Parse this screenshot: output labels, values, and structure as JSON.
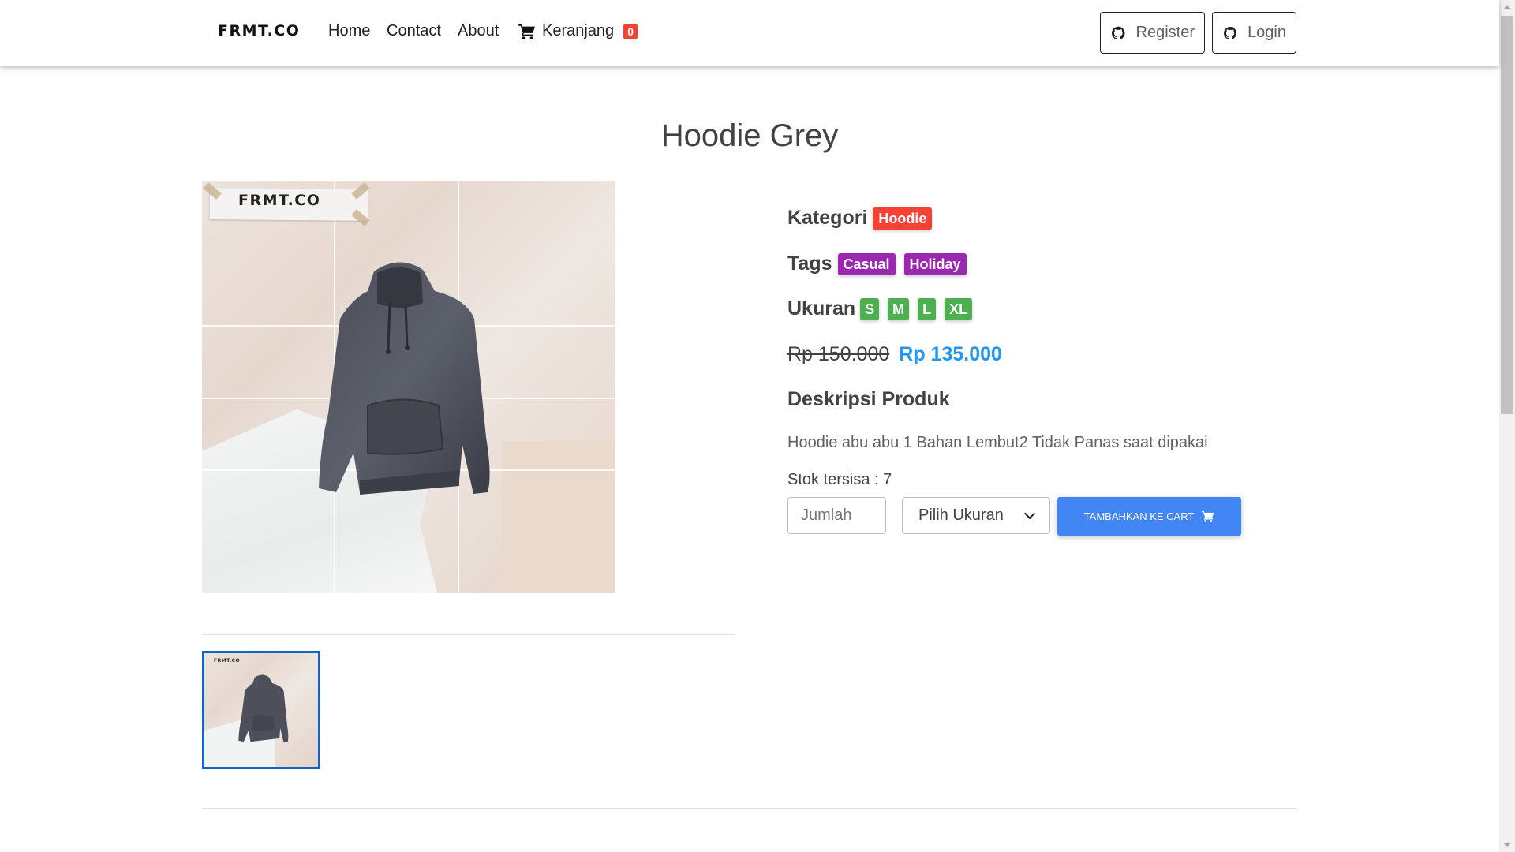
{
  "nav": {
    "brand": "FRMT.CO",
    "links": {
      "home": "Home",
      "contact": "Contact",
      "about": "About",
      "cart": "Keranjang"
    },
    "cart_count": "0",
    "register": "Register",
    "login": "Login"
  },
  "product": {
    "title": "Hoodie Grey",
    "image_logo": "FRMT.CO",
    "kategori_label": "Kategori",
    "kategori": "Hoodie",
    "tags_label": "Tags",
    "tags": [
      "Casual",
      "Holiday"
    ],
    "ukuran_label": "Ukuran",
    "sizes": [
      "S",
      "M",
      "L",
      "XL"
    ],
    "price_old": "Rp 150.000",
    "price_new": "Rp 135.000",
    "desc_title": "Deskripsi Produk",
    "desc": "Hoodie abu abu 1 Bahan Lembut2 Tidak Panas saat dipakai",
    "stock": "Stok tersisa : 7"
  },
  "form": {
    "qty_placeholder": "Jumlah",
    "size_select": "Pilih Ukuran",
    "add_to_cart": "TAMBAHKAN KE CART"
  },
  "colors": {
    "badge_category": "#f44336",
    "badge_tags": "#9c27b0",
    "badge_sizes": "#4caf50",
    "price_new": "#2196f3",
    "button": "#4285f4"
  },
  "icons": [
    "github-icon",
    "cart-icon"
  ]
}
